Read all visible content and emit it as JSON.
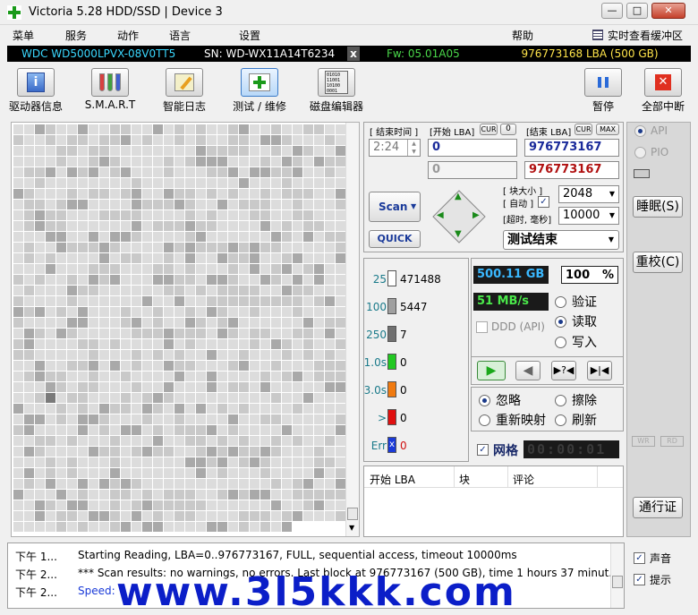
{
  "window": {
    "title": "Victoria 5.28 HDD/SSD | Device 3",
    "minimize": "—",
    "maximize": "□",
    "close": "✕"
  },
  "menu": {
    "items": [
      "菜单",
      "服务",
      "动作",
      "语言",
      "设置",
      "帮助"
    ],
    "buffer": "实时查看缓冲区"
  },
  "device": {
    "model": "WDC WD5000LPVX-08V0TT5",
    "serial": "SN: WD-WX11A14T6234",
    "x": "x",
    "firmware": "Fw: 05.01A05",
    "capacity": "976773168 LBA (500 GB)"
  },
  "toolbar": {
    "drive_info": "驱动器信息",
    "smart": "S.M.A.R.T",
    "smart_log": "智能日志",
    "test_repair": "测试 / 维修",
    "disk_editor": "磁盘编辑器",
    "pause": "暂停",
    "abort_all": "全部中断",
    "hex_icon_text": "01010\n11001\n10100\n0001"
  },
  "scan": {
    "end_time_label": "[ 结束时间 ]",
    "start_lba_label": "[开始 LBA]",
    "cur": "CUR",
    "zero": "0",
    "end_lba_label": "[结束 LBA]",
    "max": "MAX",
    "time": "2:24",
    "start_lba": "0",
    "end_lba": "976773167",
    "start_lba2": "0",
    "end_lba2": "976773167",
    "scan_button": "Scan",
    "quick_button": "QUICK",
    "block_size_label": "[ 块大小 ]",
    "auto_label": "[ 自动 ]",
    "block_size": "2048",
    "timeout_label": "[超时, 毫秒]",
    "timeout": "10000",
    "status": "测试结束"
  },
  "stats": [
    {
      "label": "25",
      "count": "471488",
      "color": "#ffffff"
    },
    {
      "label": "100",
      "count": "5447",
      "color": "#a0a0a0"
    },
    {
      "label": "250",
      "count": "7",
      "color": "#707070"
    },
    {
      "label": "1.0s",
      "count": "0",
      "color": "#22c822"
    },
    {
      "label": "3.0s",
      "count": "0",
      "color": "#f07a10"
    },
    {
      "label": ">",
      "count": "0",
      "color": "#e01010"
    },
    {
      "label": "Err",
      "count": "0",
      "color": "#1a3ad8"
    }
  ],
  "progress": {
    "size": "500.11 GB",
    "percent": "100",
    "percent_sign": "%",
    "speed": "51 MB/s",
    "ddd": "DDD (API)"
  },
  "mode": {
    "verify": "验证",
    "read": "读取",
    "write": "写入"
  },
  "actions": {
    "ignore": "忽略",
    "erase": "擦除",
    "remap": "重新映射",
    "refresh": "刷新"
  },
  "grid_label": "网格",
  "timer": "00:00:01",
  "table": {
    "headers": [
      "开始 LBA",
      "块",
      "评论"
    ]
  },
  "right": {
    "api": "API",
    "pio": "PIO",
    "sleep": "睡眠(S)",
    "recal": "重校(C)",
    "wr": "WR",
    "rd": "RD",
    "passport": "通行证",
    "sound": "声音",
    "hints": "提示"
  },
  "log": [
    {
      "time": "下午 1...",
      "msg": "Starting Reading, LBA=0..976773167, FULL, sequential access, timeout 10000ms"
    },
    {
      "time": "下午 2...",
      "msg": "*** Scan results: no warnings, no errors. Last block at 976773167 (500 GB), time 1 hours 37 minut..."
    },
    {
      "time": "下午 2...",
      "msg": "Speed: "
    }
  ],
  "watermark": "www.3l5kkk.com"
}
